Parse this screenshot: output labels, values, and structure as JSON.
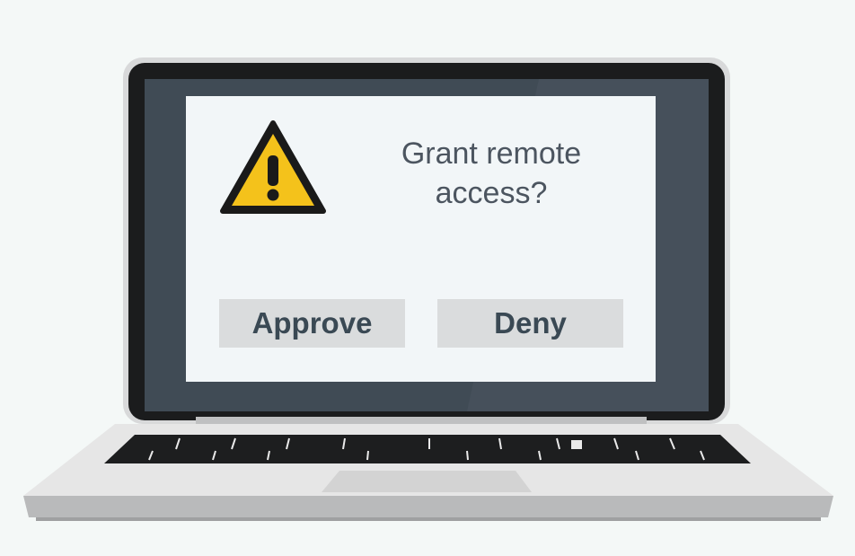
{
  "dialog": {
    "prompt_line1": "Grant remote",
    "prompt_line2": "access?",
    "approve_label": "Approve",
    "deny_label": "Deny"
  },
  "icons": {
    "warning": "warning-icon"
  },
  "colors": {
    "background": "#f4f8f7",
    "laptop_bezel": "#1b1c1d",
    "screen_backdrop": "#404b55",
    "dialog_background": "#f2f6f8",
    "button_background": "#dadcdd",
    "button_text": "#3a4954",
    "prompt_text": "#4c5560",
    "warning_fill": "#f4c21b",
    "laptop_body": "#e9e9e9"
  }
}
